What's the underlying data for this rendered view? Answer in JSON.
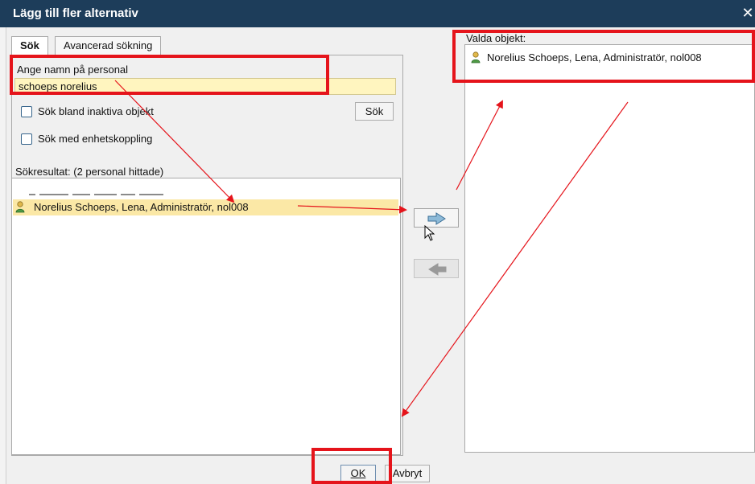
{
  "window": {
    "title": "Lägg till fler alternativ",
    "close_glyph": "✕"
  },
  "tabs": [
    {
      "label": "Sök",
      "active": true
    },
    {
      "label": "Avancerad sökning",
      "active": false
    }
  ],
  "search": {
    "name_label": "Ange namn på personal",
    "name_value": "schoeps norelius",
    "inactive_checkbox_label": "Sök bland inaktiva objekt",
    "inactive_checked": false,
    "unit_checkbox_label": "Sök med enhetskoppling",
    "unit_checked": false,
    "search_button": "Sök"
  },
  "results": {
    "label": "Sökresultat: (2 personal hittade)",
    "items": [
      {
        "text": "Norelius Schoeps, Lena, Administratör, nol008",
        "selected": true,
        "icon": "person-icon"
      }
    ]
  },
  "selected_objects": {
    "label": "Valda objekt:",
    "items": [
      {
        "text": "Norelius Schoeps, Lena, Administratör, nol008",
        "icon": "person-icon"
      }
    ]
  },
  "buttons": {
    "ok": "OK",
    "cancel": "Avbryt",
    "add_icon": "arrow-right-icon",
    "remove_icon": "arrow-left-icon"
  },
  "annotations": {
    "color": "#e5141b"
  },
  "colors": {
    "titlebar": "#1d3d5a",
    "input_highlight": "#fff5bf",
    "selected_row": "#fbe8a6",
    "arrow_blue": "#8dbad8"
  }
}
